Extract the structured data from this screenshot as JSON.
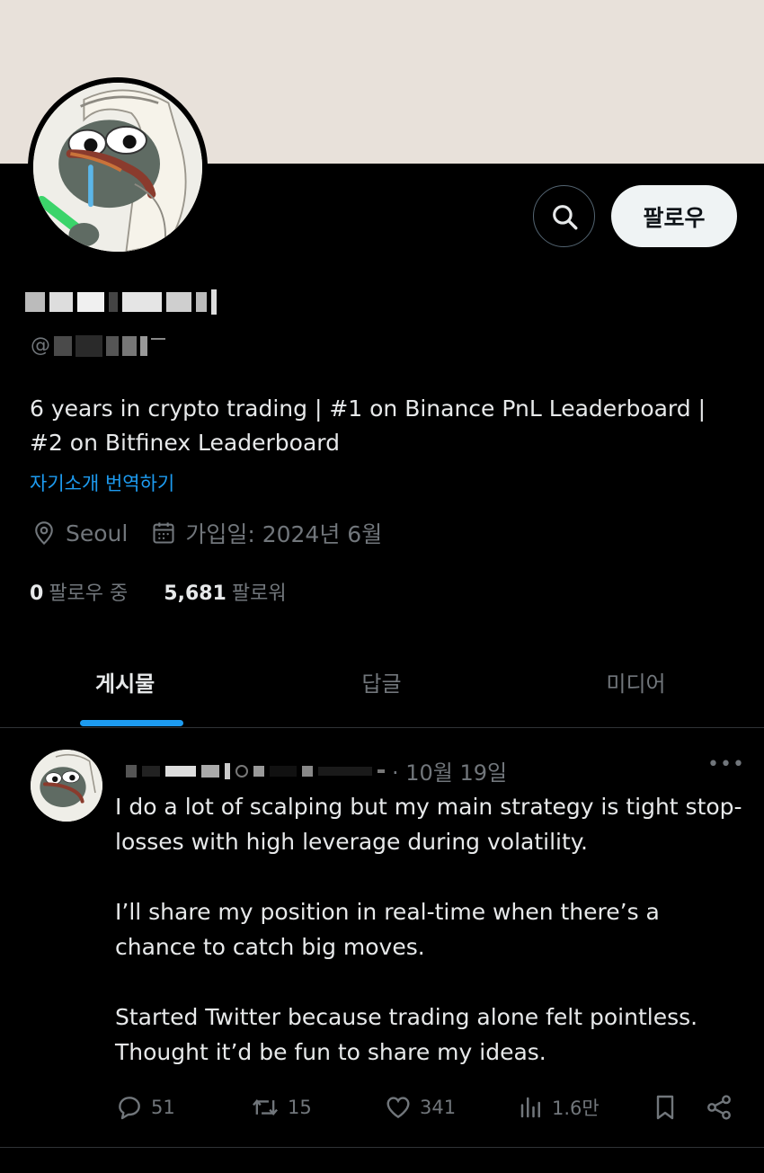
{
  "profile": {
    "follow_label": "팔로우",
    "bio": "6 years in crypto trading | #1 on Binance PnL Leaderboard | #2 on Bitfinex Leaderboard",
    "translate_label": "자기소개 번역하기",
    "location": "Seoul",
    "joined": "가입일: 2024년 6월",
    "following_count": "0",
    "following_label": "팔로우 중",
    "followers_count": "5,681",
    "followers_label": "팔로워",
    "handle_prefix": "@"
  },
  "tabs": [
    {
      "label": "게시물",
      "active": true
    },
    {
      "label": "답글",
      "active": false
    },
    {
      "label": "미디어",
      "active": false
    }
  ],
  "post": {
    "date": "· 10월 19일",
    "more": "•••",
    "paragraphs": [
      "I do a lot of scalping but my main strategy is tight stop-losses with high leverage during volatility.",
      "I’ll share my position in real-time when there’s a chance to catch big moves.",
      "Started Twitter because trading alone felt pointless. Thought it’d be fun to share my ideas."
    ],
    "replies": "51",
    "reposts": "15",
    "likes": "341",
    "views": "1.6만"
  },
  "icons": {
    "search": "search-icon",
    "location": "location-pin-icon",
    "calendar": "calendar-icon",
    "reply": "reply-icon",
    "repost": "repost-icon",
    "like": "heart-icon",
    "views": "views-icon",
    "bookmark": "bookmark-icon",
    "share": "share-icon"
  },
  "colors": {
    "background": "#000000",
    "banner": "#e8e1da",
    "accent": "#1d9bf0",
    "muted": "#71767b",
    "text": "#e7e9ea"
  }
}
